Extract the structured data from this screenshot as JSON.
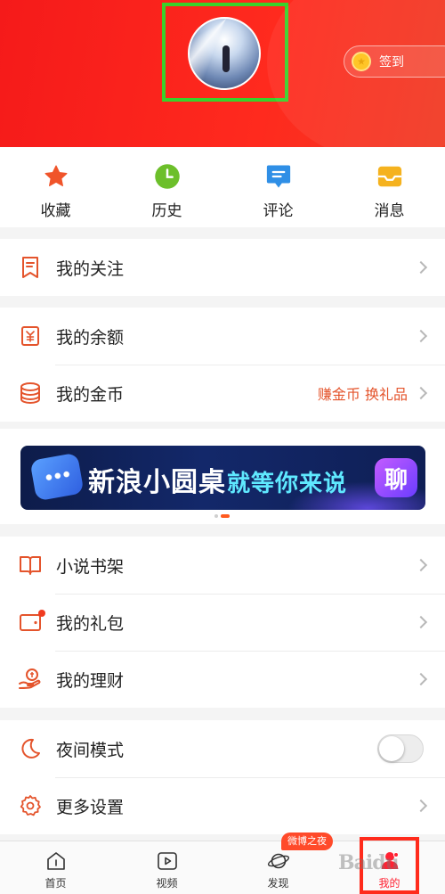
{
  "header": {
    "signin_label": "签到"
  },
  "quick": [
    {
      "label": "收藏",
      "icon": "star-icon",
      "color": "#f0542a"
    },
    {
      "label": "历史",
      "icon": "clock-icon",
      "color": "#6cbf2a"
    },
    {
      "label": "评论",
      "icon": "comment-icon",
      "color": "#2f8fe6"
    },
    {
      "label": "消息",
      "icon": "inbox-icon",
      "color": "#f5b21e"
    }
  ],
  "menu": {
    "follow": "我的关注",
    "balance": "我的余额",
    "coins": "我的金币",
    "coins_extra": "赚金币 换礼品",
    "novel": "小说书架",
    "gift": "我的礼包",
    "finance": "我的理财",
    "night_mode": "夜间模式",
    "more_settings": "更多设置"
  },
  "banner": {
    "title": "新浪小圆桌",
    "subtitle": "就等你来说",
    "chip": "聊"
  },
  "tabbar": {
    "home": "首页",
    "video": "视频",
    "discover": "发现",
    "discover_badge": "微博之夜",
    "me": "我的"
  },
  "night_mode_on": false,
  "watermark": "Baidu",
  "colors": {
    "accent": "#f23a1f",
    "header_red": "#f51a1a",
    "icon_orange": "#e4542c"
  }
}
